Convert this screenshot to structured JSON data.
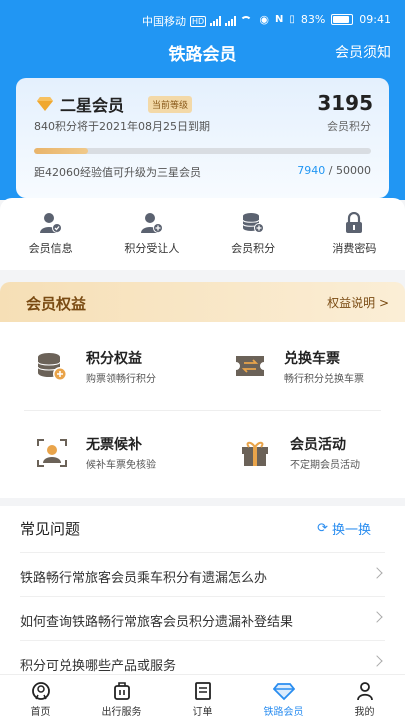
{
  "status": {
    "carrier": "中国移动",
    "network": "HD",
    "battery": "83%",
    "time": "09:41"
  },
  "header": {
    "title": "铁路会员",
    "notice": "会员须知"
  },
  "member_card": {
    "level_name": "二星会员",
    "level_badge": "当前等级",
    "expire_text": "840积分将于2021年08月25日到期",
    "points": "3195",
    "points_label": "会员积分",
    "upgrade_text": "距42060经验值可升级为三星会员",
    "exp_current": "7940",
    "exp_sep": " / ",
    "exp_target": "50000",
    "progress_fraction": 0.1588
  },
  "quick_actions": [
    {
      "label": "会员信息",
      "icon": "member-info-icon"
    },
    {
      "label": "积分受让人",
      "icon": "points-transferee-icon"
    },
    {
      "label": "会员积分",
      "icon": "member-points-icon"
    },
    {
      "label": "消费密码",
      "icon": "lock-icon"
    }
  ],
  "benefits": {
    "title": "会员权益",
    "more": "权益说明 >",
    "items": [
      {
        "name": "积分权益",
        "desc": "购票领畅行积分",
        "icon": "coins-icon"
      },
      {
        "name": "兑换车票",
        "desc": "畅行积分兑换车票",
        "icon": "ticket-icon"
      },
      {
        "name": "无票候补",
        "desc": "候补车票免核验",
        "icon": "waitlist-icon"
      },
      {
        "name": "会员活动",
        "desc": "不定期会员活动",
        "icon": "gift-icon"
      }
    ]
  },
  "faq": {
    "title": "常见问题",
    "refresh": "换一换",
    "items": [
      "铁路畅行常旅客会员乘车积分有遗漏怎么办",
      "如何查询铁路畅行常旅客会员积分遗漏补登结果",
      "积分可兑换哪些产品或服务"
    ]
  },
  "tabs": [
    {
      "label": "首页",
      "icon": "train-icon",
      "active": false
    },
    {
      "label": "出行服务",
      "icon": "luggage-icon",
      "active": false
    },
    {
      "label": "订单",
      "icon": "order-icon",
      "active": false
    },
    {
      "label": "铁路会员",
      "icon": "diamond-icon",
      "active": true
    },
    {
      "label": "我的",
      "icon": "person-icon",
      "active": false
    }
  ],
  "colors": {
    "primary": "#2196f3",
    "gold": "#7a4b13",
    "link": "#2a8df0"
  }
}
